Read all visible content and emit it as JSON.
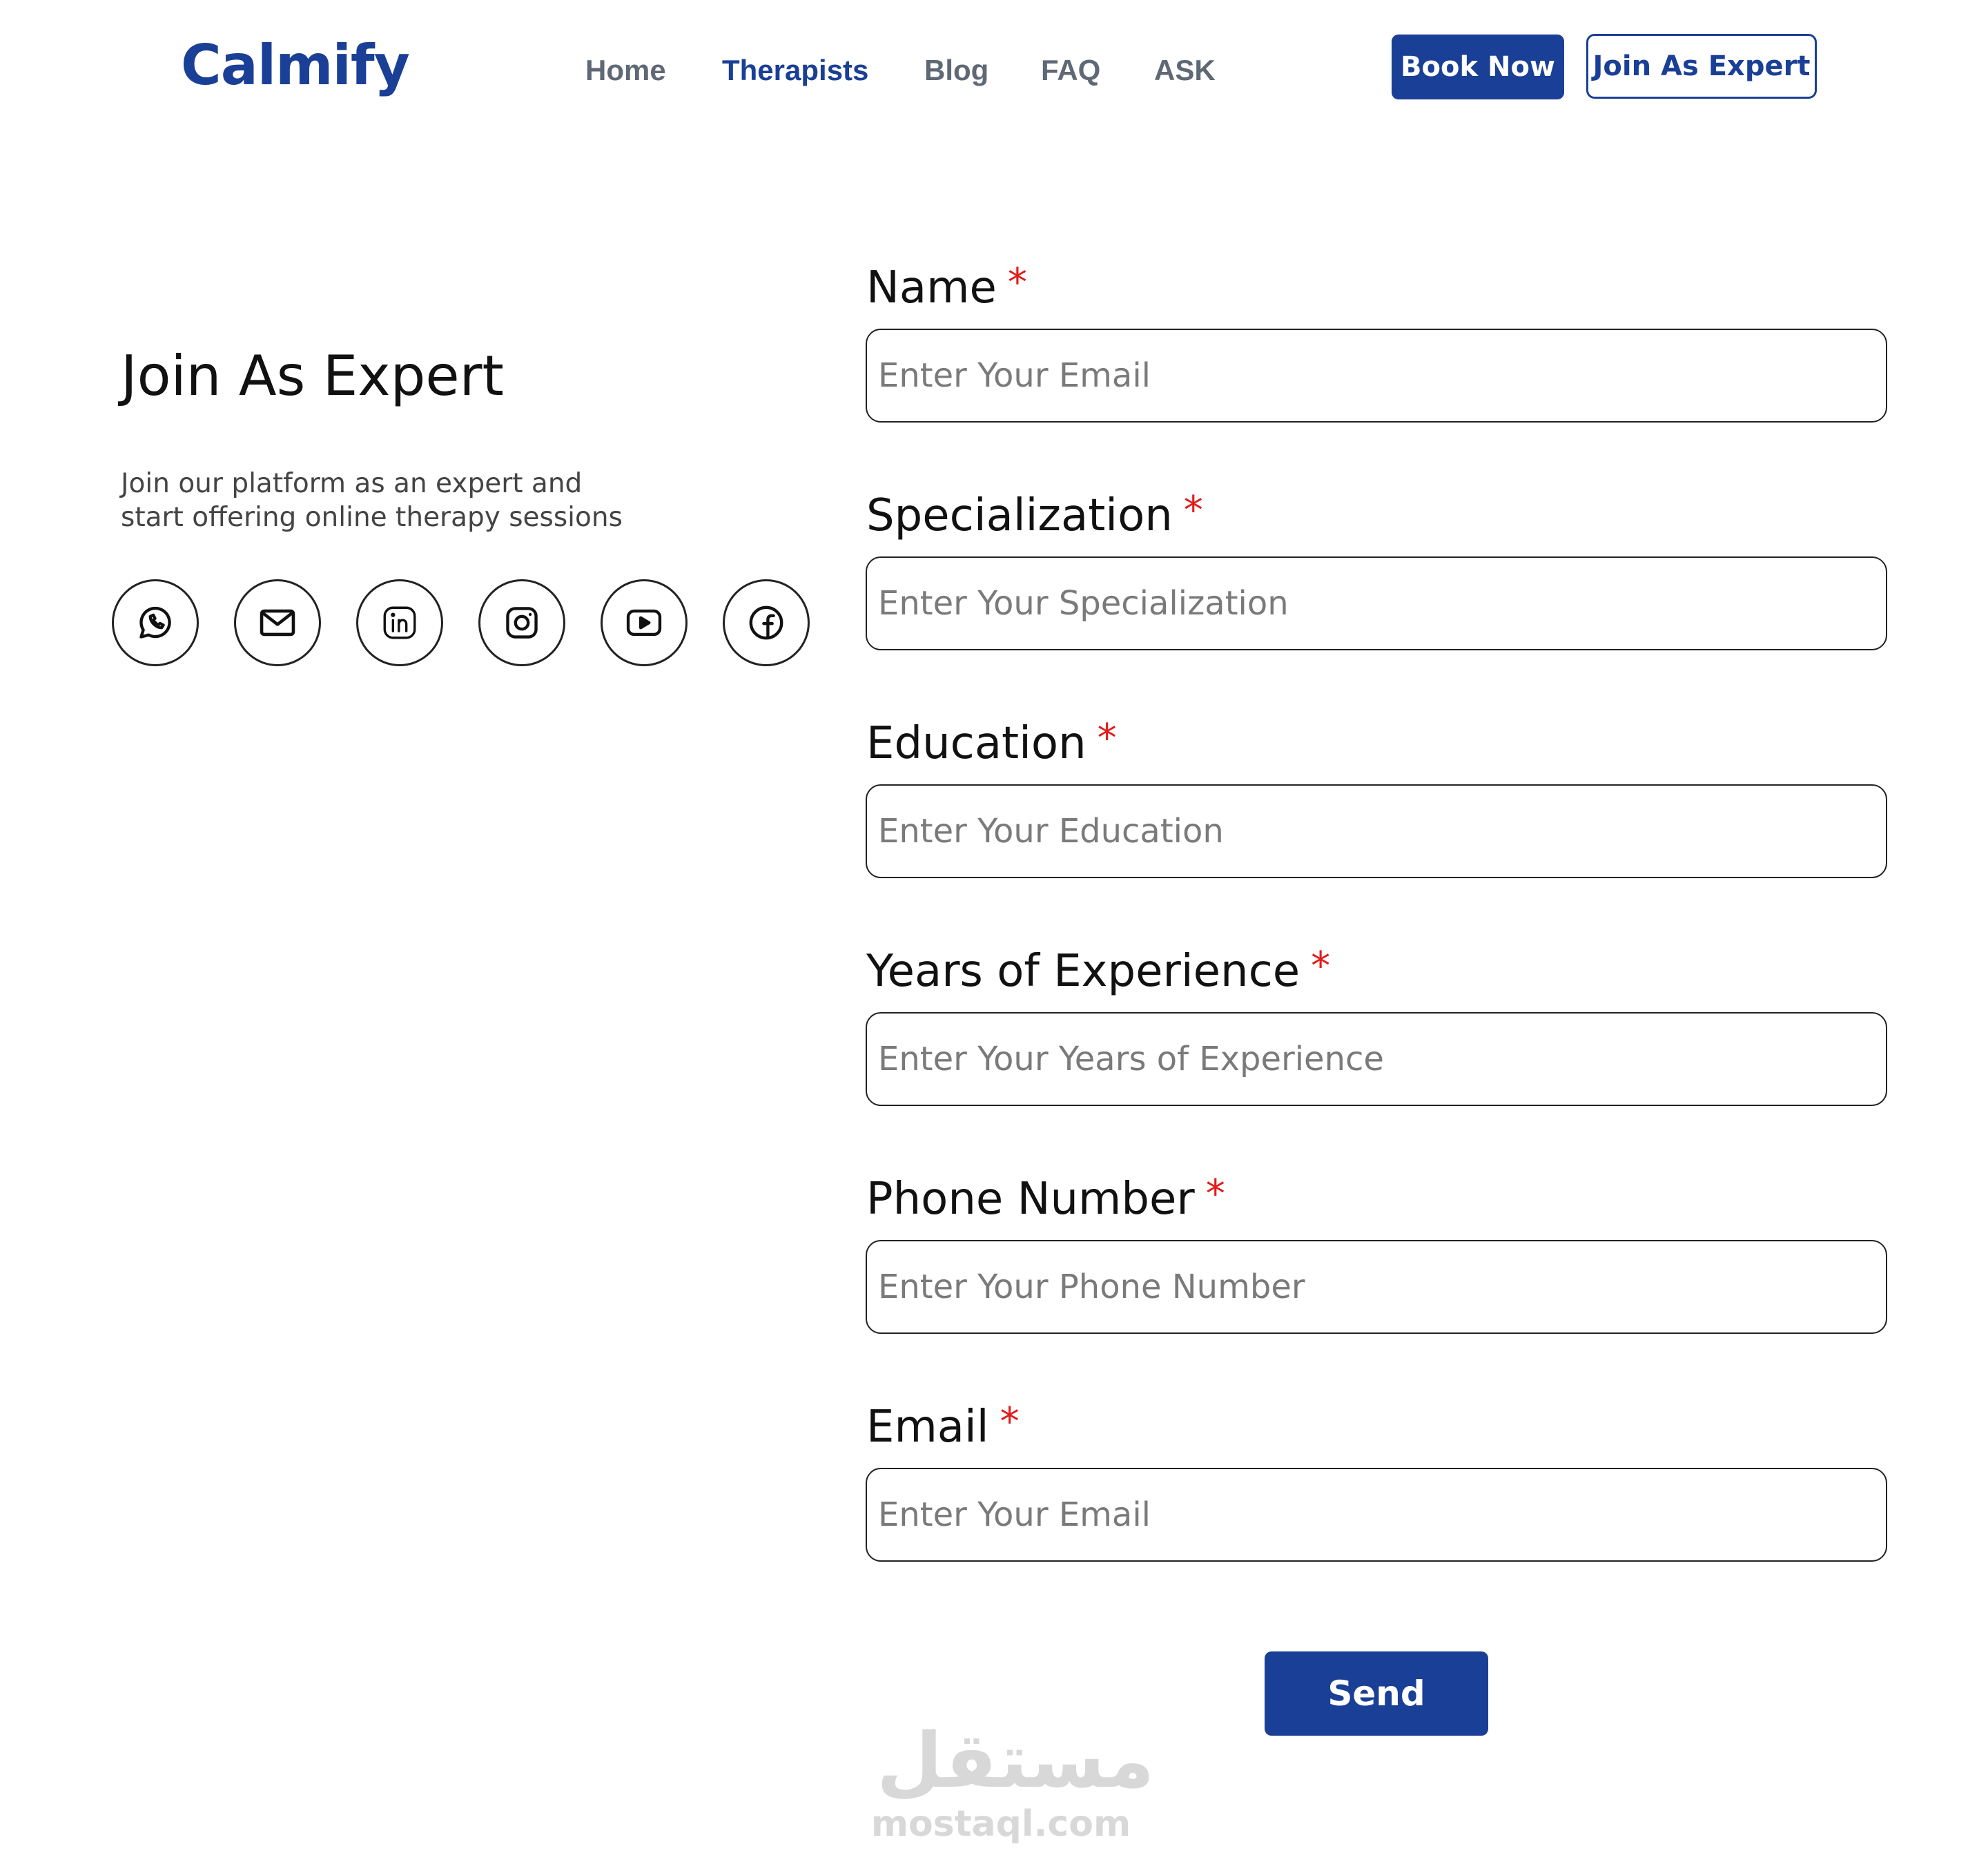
{
  "brand": {
    "name": "Calmify",
    "accent": "#1a3f96",
    "required_color": "#e31b1b"
  },
  "nav": {
    "items": [
      {
        "label": "Home",
        "active": false
      },
      {
        "label": "Therapists",
        "active": true
      },
      {
        "label": "Blog",
        "active": false
      },
      {
        "label": "FAQ",
        "active": false
      },
      {
        "label": "ASK",
        "active": false
      }
    ],
    "book_label": "Book Now",
    "join_label": "Join As Expert"
  },
  "intro": {
    "title": "Join As Expert",
    "text_line1": "Join our platform as an expert and",
    "text_line2": "start offering online therapy sessions",
    "social_icons": [
      "whatsapp-icon",
      "email-icon",
      "linkedin-icon",
      "instagram-icon",
      "youtube-icon",
      "facebook-icon"
    ]
  },
  "form": {
    "required_mark": "*",
    "fields": [
      {
        "label": "Name",
        "placeholder": "Enter Your Email",
        "value": ""
      },
      {
        "label": "Specialization",
        "placeholder": "Enter Your Specialization",
        "value": ""
      },
      {
        "label": "Education",
        "placeholder": "Enter Your Education",
        "value": ""
      },
      {
        "label": "Years of Experience",
        "placeholder": "Enter Your Years of Experience",
        "value": ""
      },
      {
        "label": "Phone Number",
        "placeholder": "Enter Your Phone Number",
        "value": ""
      },
      {
        "label": "Email",
        "placeholder": "Enter Your Email",
        "value": ""
      }
    ],
    "submit_label": "Send"
  },
  "watermark": {
    "arabic": "مستقل",
    "latin": "mostaql.com"
  }
}
